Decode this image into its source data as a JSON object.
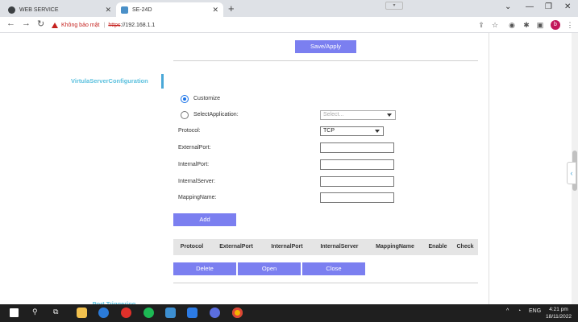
{
  "browser": {
    "tabs": [
      {
        "title": "WEB SERVICE",
        "active": false
      },
      {
        "title": "SE-24D",
        "active": true
      }
    ],
    "address": {
      "security_label": "Không bảo mật",
      "separator": "|",
      "scheme": "https",
      "host": "://192.168.1.1"
    },
    "profile_initial": "b"
  },
  "sidebar": {
    "items": [
      {
        "label": "VirtulaServerConfiguration",
        "active": true
      },
      {
        "label": "Port Triggering",
        "active": false
      }
    ]
  },
  "form": {
    "save_apply_label": "Save/Apply",
    "mode_options": [
      {
        "label": "Customize",
        "checked": true
      },
      {
        "label": "SelectApplication:",
        "checked": false
      }
    ],
    "select_application": {
      "placeholder": "Select..."
    },
    "protocol": {
      "label": "Protocol:",
      "value": "TCP"
    },
    "fields": [
      {
        "label": "ExternalPort:",
        "value": ""
      },
      {
        "label": "InternalPort:",
        "value": ""
      },
      {
        "label": "InternalServer:",
        "value": ""
      },
      {
        "label": "MappingName:",
        "value": ""
      }
    ],
    "add_label": "Add"
  },
  "table": {
    "columns": [
      "Protocol",
      "ExternalPort",
      "InternalPort",
      "InternalServer",
      "MappingName",
      "Enable",
      "Check"
    ]
  },
  "actions": {
    "delete_label": "Delete",
    "open_label": "Open",
    "close_label": "Close"
  },
  "taskbar": {
    "language": "ENG",
    "time": "4:21 pm",
    "date": "18/11/2022"
  },
  "colors": {
    "accent_button": "#7b7ff0",
    "sidebar_text": "#5bc0de",
    "warning": "#c5221f"
  }
}
